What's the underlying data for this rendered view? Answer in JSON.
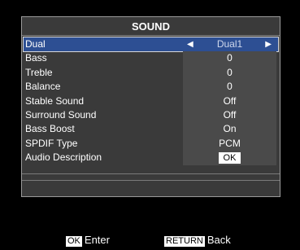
{
  "menu": {
    "title": "SOUND",
    "rows": [
      {
        "label": "Dual",
        "value": "Dual1"
      },
      {
        "label": "Bass",
        "value": "0"
      },
      {
        "label": "Treble",
        "value": "0"
      },
      {
        "label": "Balance",
        "value": "0"
      },
      {
        "label": "Stable Sound",
        "value": "Off"
      },
      {
        "label": "Surround Sound",
        "value": "Off"
      },
      {
        "label": "Bass Boost",
        "value": "On"
      },
      {
        "label": "SPDIF Type",
        "value": "PCM"
      },
      {
        "label": "Audio Description",
        "value": "OK"
      }
    ],
    "selected_index": 0
  },
  "icons": {
    "left": "left-arrow-icon",
    "right": "right-arrow-icon"
  },
  "footer": {
    "ok_key": "OK",
    "ok_label": "Enter",
    "return_key": "RETURN",
    "return_label": "Back"
  },
  "colors": {
    "selection": "#2d4f93",
    "panel": "#3a3a3a",
    "value_bg": "#4a4a4a"
  }
}
